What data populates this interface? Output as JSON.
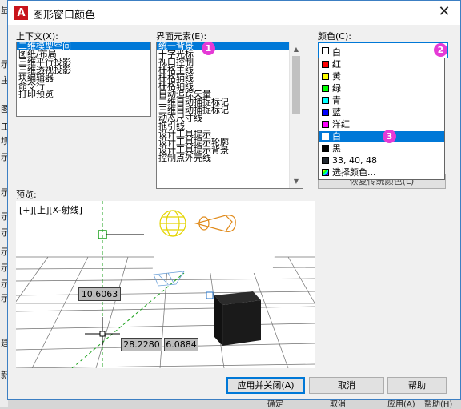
{
  "background": {
    "left_chars": [
      "显",
      "示",
      "主",
      "图",
      "工",
      "坝",
      "示",
      "示",
      "示",
      "示",
      "示",
      "示",
      "示",
      "示",
      "建",
      "新"
    ],
    "bottom_buttons": [
      "确定",
      "取消",
      "应用(A)",
      "帮助(H)"
    ]
  },
  "dialog": {
    "title": "图形窗口颜色",
    "close_glyph": "✕"
  },
  "context": {
    "label": "上下文(X):",
    "items": [
      "二维模型空间",
      "图纸/布局",
      "三维平行投影",
      "三维透视投影",
      "块编辑器",
      "命令行",
      "打印预览"
    ],
    "selected_index": 0
  },
  "elements": {
    "label": "界面元素(E):",
    "items": [
      "统一背景",
      "十字光标",
      "视口控制",
      "栅格主线",
      "栅格辅线",
      "栅格轴线",
      "自动追踪矢量",
      "二维自动捕捉标记",
      "三维自动捕捉标记",
      "动态尺寸线",
      "拖引线",
      "设计工具提示",
      "设计工具提示轮廓",
      "设计工具提示背景",
      "控制点外壳线"
    ],
    "selected_index": 0
  },
  "color": {
    "label": "颜色(C):",
    "current": "白",
    "options": [
      {
        "label": "红",
        "color": "#ff0000"
      },
      {
        "label": "黄",
        "color": "#ffff00"
      },
      {
        "label": "绿",
        "color": "#00ff00"
      },
      {
        "label": "青",
        "color": "#00ffff"
      },
      {
        "label": "蓝",
        "color": "#0000ff"
      },
      {
        "label": "洋红",
        "color": "#ff00ff"
      },
      {
        "label": "白",
        "color": "#ffffff"
      },
      {
        "label": "黑",
        "color": "#000000"
      },
      {
        "label": "33, 40, 48",
        "color": "#212830"
      },
      {
        "label": "选择颜色...",
        "color": "gradient"
      }
    ],
    "selected_index": 6,
    "restore_label": "恢复传统颜色(L)"
  },
  "badges": [
    "1",
    "2",
    "3"
  ],
  "preview": {
    "section_label": "预览:",
    "viewport_label": "[+][上][X-射线]",
    "dim1": "10.6063",
    "dim2": "28.2280",
    "dim3": "6.0884"
  },
  "buttons": {
    "apply_close": "应用并关闭(A)",
    "cancel": "取消",
    "help": "帮助"
  },
  "accent_color": "#0078d7",
  "badge_color": "#e53ad6"
}
